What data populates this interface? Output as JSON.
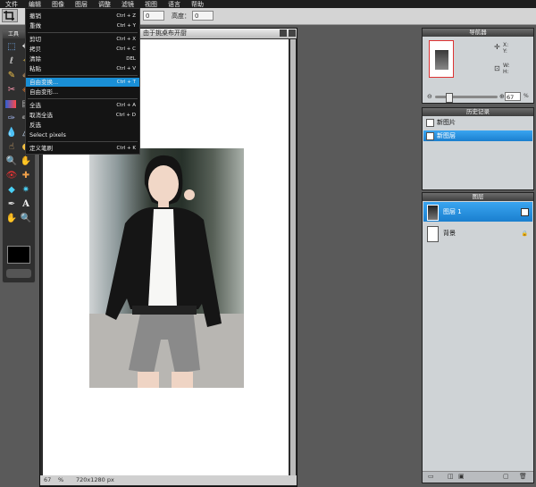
{
  "menubar": {
    "items": [
      "文件",
      "编辑",
      "图像",
      "图层",
      "调整",
      "滤镜",
      "视图",
      "语言",
      "帮助"
    ]
  },
  "options": {
    "field1": "",
    "field2": "0",
    "height_label": "高度：",
    "height_value": "0"
  },
  "toolbox": {
    "title": "工具"
  },
  "edit_menu": {
    "items": [
      {
        "label": "撤销",
        "shortcut": "Ctrl + Z"
      },
      {
        "label": "重做",
        "shortcut": "Ctrl + Y"
      },
      {
        "label": "剪切",
        "shortcut": "Ctrl + X"
      },
      {
        "label": "拷贝",
        "shortcut": "Ctrl + C"
      },
      {
        "label": "清除",
        "shortcut": "DEL"
      },
      {
        "label": "粘贴",
        "shortcut": "Ctrl + V"
      },
      {
        "label": "自由变换...",
        "shortcut": "Ctrl + T"
      },
      {
        "label": "自由变形...",
        "shortcut": ""
      },
      {
        "label": "全选",
        "shortcut": "Ctrl + A"
      },
      {
        "label": "取消全选",
        "shortcut": "Ctrl + D"
      },
      {
        "label": "反选",
        "shortcut": ""
      },
      {
        "label": "Select pixels",
        "shortcut": ""
      },
      {
        "label": "定义笔刷",
        "shortcut": "Ctrl + K"
      }
    ]
  },
  "document": {
    "title": "由于挑桌布开厨",
    "zoom": "67",
    "zoom_unit": "%",
    "size": "720x1280 px"
  },
  "navigator": {
    "title": "导航器",
    "x_label": "X:",
    "y_label": "Y:",
    "w_label": "W:",
    "h_label": "H:",
    "zoom": "67"
  },
  "history": {
    "title": "历史记录",
    "items": [
      "新图片",
      "新图层"
    ]
  },
  "layers": {
    "title": "图层",
    "items": [
      "图层 1",
      "背景"
    ]
  },
  "colors": {
    "accent": "#1a8fd6",
    "menubar": "#1e1e1e",
    "panel": "#cfd3d6"
  }
}
